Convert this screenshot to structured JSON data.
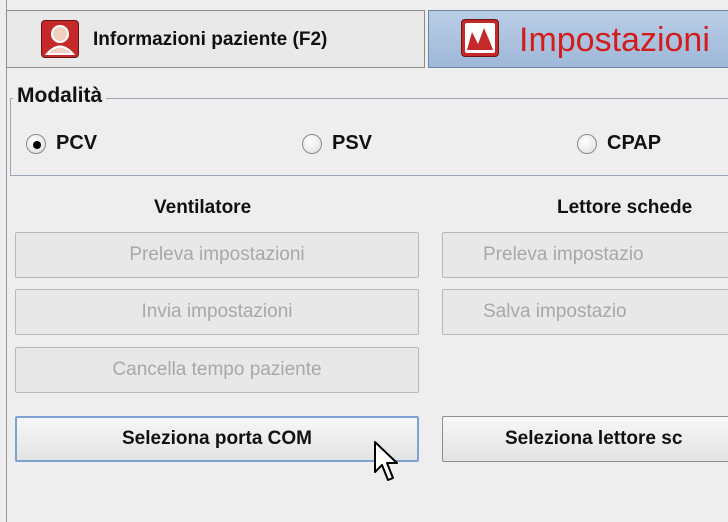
{
  "tabs": [
    {
      "label": "Informazioni paziente (F2)",
      "icon": "patient-icon"
    },
    {
      "label": "Impostazioni",
      "icon": "settings-graph-icon"
    }
  ],
  "modalita": {
    "title": "Modalità",
    "options": [
      {
        "label": "PCV",
        "checked": true
      },
      {
        "label": "PSV",
        "checked": false
      },
      {
        "label": "CPAP",
        "checked": false
      }
    ]
  },
  "ventilatore": {
    "title": "Ventilatore",
    "preleva": "Preleva impostazioni",
    "invia": "Invia impostazioni",
    "cancella": "Cancella tempo paziente",
    "seleziona_com": "Seleziona porta COM"
  },
  "lettore": {
    "title": "Lettore schede",
    "preleva": "Preleva impostazio",
    "salva": "Salva impostazio",
    "seleziona": "Seleziona lettore sc"
  },
  "colors": {
    "accent": "#d21d1d",
    "tab_active": "#a9c0de"
  }
}
